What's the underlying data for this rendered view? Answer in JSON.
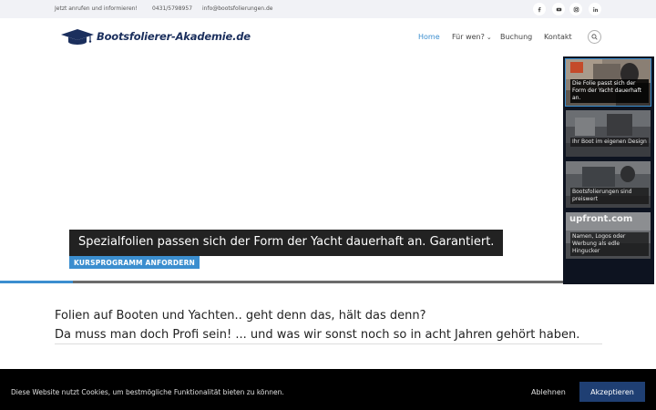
{
  "topbar": {
    "call_text": "Jetzt anrufen und informieren!",
    "phone": "0431/5798957",
    "email": "info@bootsfolierungen.de",
    "social_icons": [
      "facebook-icon",
      "youtube-icon",
      "instagram-icon",
      "linkedin-icon"
    ]
  },
  "header": {
    "logo_text": "Bootsfolierer-Akademie.de",
    "nav": {
      "home": "Home",
      "fuer_wen": "Für wen?",
      "buchung": "Buchung",
      "kontakt": "Kontakt"
    }
  },
  "slider": {
    "caption": "Spezialfolien passen sich der Form der Yacht dauerhaft an. Garantiert.",
    "cta_label": "KURSPROGRAMM ANFORDERN",
    "progress": 0.13,
    "thumbs": [
      {
        "caption": "Die Folie passt sich der Form der Yacht dauerhaft an."
      },
      {
        "caption": "Ihr Boot im eigenen Design"
      },
      {
        "caption": "Bootsfolierungen sind preiswert"
      },
      {
        "caption": "Namen, Logos oder Werbung als edle Hingucker"
      }
    ],
    "thumb_brand_text": "upfront.com"
  },
  "intro": {
    "line1": "Folien auf Booten und Yachten.. geht denn das, hält das denn?",
    "line2": "Da muss man doch Profi sein! ... und was wir sonst noch so in acht Jahren gehört haben."
  },
  "cookie": {
    "text": "Diese Website nutzt Cookies, um bestmögliche Funktionalität bieten zu können.",
    "decline": "Ablehnen",
    "accept": "Akzeptieren"
  },
  "colors": {
    "accent": "#3b8ecf",
    "brand_navy": "#1b2f5d",
    "accept_button": "#1f3f73",
    "cookie_bg": "#000000"
  }
}
